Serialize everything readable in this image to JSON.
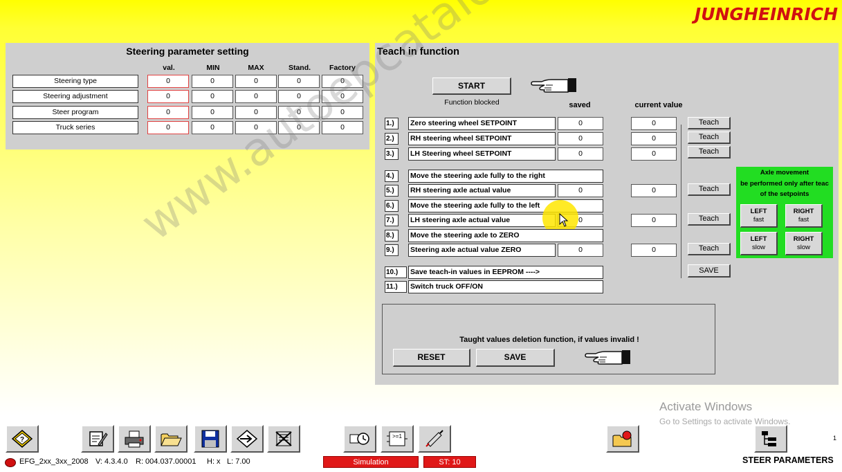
{
  "brand": {
    "logo_text": "JUNGHEINRICH",
    "color": "#d01010"
  },
  "steering_panel": {
    "title": "Steering parameter setting",
    "columns": [
      "val.",
      "MIN",
      "MAX",
      "Stand.",
      "Factory"
    ],
    "rows": [
      {
        "label": "Steering type",
        "values": [
          "0",
          "0",
          "0",
          "0",
          "0"
        ]
      },
      {
        "label": "Steering adjustment",
        "values": [
          "0",
          "0",
          "0",
          "0",
          "0"
        ]
      },
      {
        "label": "Steer program",
        "values": [
          "0",
          "0",
          "0",
          "0",
          "0"
        ]
      },
      {
        "label": "Truck series",
        "values": [
          "0",
          "0",
          "0",
          "0",
          "0"
        ]
      }
    ]
  },
  "teach_panel": {
    "title": "Teach in function",
    "start_label": "START",
    "function_status": "Function blocked",
    "saved_header": "saved",
    "current_header": "current value",
    "steps": [
      {
        "num": "1.)",
        "text": "Zero steering wheel SETPOINT",
        "saved": "0",
        "current": "0",
        "teach": "Teach"
      },
      {
        "num": "2.)",
        "text": "RH steering wheel SETPOINT",
        "saved": "0",
        "current": "0",
        "teach": "Teach"
      },
      {
        "num": "3.)",
        "text": "LH Steering wheel SETPOINT",
        "saved": "0",
        "current": "0",
        "teach": "Teach"
      },
      {
        "num": "4.)",
        "text": "Move the steering axle fully to the right"
      },
      {
        "num": "5.)",
        "text": "RH steering axle actual value",
        "saved": "0",
        "current": "0",
        "teach": "Teach"
      },
      {
        "num": "6.)",
        "text": "Move the steering axle fully to the left"
      },
      {
        "num": "7.)",
        "text": "LH steering axle actual value",
        "saved": "0",
        "current": "0",
        "teach": "Teach"
      },
      {
        "num": "8.)",
        "text": "Move the steering axle to ZERO"
      },
      {
        "num": "9.)",
        "text": "Steering axle actual value ZERO",
        "saved": "0",
        "current": "0",
        "teach": "Teach"
      },
      {
        "num": "10.)",
        "text": "Save teach-in values in EEPROM ---->",
        "save": "SAVE"
      },
      {
        "num": "11.)",
        "text": "Switch truck OFF/ON"
      }
    ],
    "axle": {
      "title": "Axle movement",
      "line2": "be performed only after teac",
      "line3": "of the setpoints",
      "left_fast": [
        "LEFT",
        "fast"
      ],
      "right_fast": [
        "RIGHT",
        "fast"
      ],
      "left_slow": [
        "LEFT",
        "slow"
      ],
      "right_slow": [
        "RIGHT",
        "slow"
      ],
      "color": "#22dd22"
    },
    "delete_box": {
      "text": "Taught values deletion function, if values invalid !",
      "reset_label": "RESET",
      "save_label": "SAVE"
    }
  },
  "activate_windows": {
    "title": "Activate Windows",
    "subtitle": "Go to Settings to activate Windows."
  },
  "toolbar": {
    "icons": [
      "help-icon",
      "edit-icon",
      "print-icon",
      "open-folder-icon",
      "save-disk-icon",
      "navigate-icon",
      "delete-icon",
      "clock-icon",
      "program-icon",
      "probe-icon",
      "folder-error-icon",
      "tree-icon"
    ]
  },
  "status_bar": {
    "file": "EFG_2xx_3xx_2008",
    "version": "V: 4.3.4.0",
    "revision": "R: 004.037.00001",
    "h": "H: x",
    "l": "L: 7.00",
    "mode": "Simulation",
    "st": "ST: 10",
    "page": "1",
    "screen_title": "STEER PARAMETERS"
  },
  "watermark": "www.autoepcatalog.com"
}
